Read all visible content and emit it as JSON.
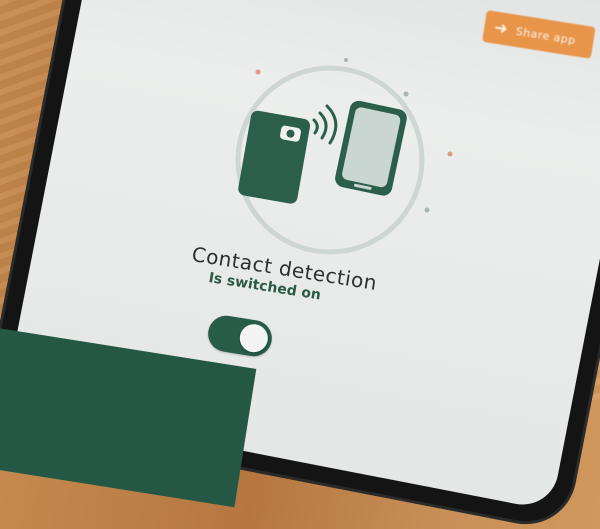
{
  "share_button": {
    "label": "Share app",
    "icon": "arrow-right-icon"
  },
  "feature": {
    "title": "Contact detection",
    "status": "Is switched on"
  },
  "toggle": {
    "state": "on"
  },
  "colors": {
    "accent_green": "#265c48",
    "share_orange": "#e8954a",
    "screen_background": "#e4e7e6"
  }
}
